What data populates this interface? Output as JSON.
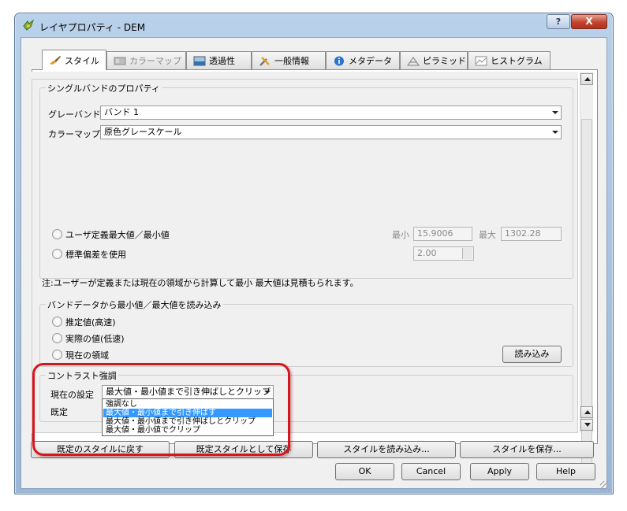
{
  "window": {
    "title": "レイヤプロパティ - DEM",
    "help_glyph": "?",
    "close_glyph": "X"
  },
  "tabs": [
    {
      "label": "スタイル",
      "icon": "brush-icon",
      "active": true
    },
    {
      "label": "カラーマップ",
      "icon": "colormap-icon",
      "disabled": true
    },
    {
      "label": "透過性",
      "icon": "transparency-icon"
    },
    {
      "label": "一般情報",
      "icon": "tools-icon"
    },
    {
      "label": "メタデータ",
      "icon": "info-icon"
    },
    {
      "label": "ピラミッド",
      "icon": "pyramid-icon"
    },
    {
      "label": "ヒストグラム",
      "icon": "histogram-icon"
    }
  ],
  "single_band": {
    "group_title": "シングルバンドのプロパティ",
    "gray_band_label": "グレーバンド",
    "gray_band_value": "バンド 1",
    "colormap_label": "カラーマップ",
    "colormap_value": "原色グレースケール",
    "user_minmax_label": "ユーザ定義最大値／最小値",
    "min_label": "最小",
    "min_value": "15.9006",
    "max_label": "最大",
    "max_value": "1302.28",
    "stddev_label": "標準偏差を使用",
    "stddev_value": "2.00"
  },
  "note": "注:ユーザーが定義または現在の領域から計算して最小 最大値は見積もられます。",
  "load_minmax": {
    "group_title": "バンドデータから最小値／最大値を読み込み",
    "options": [
      "推定値(高速)",
      "実際の値(低速)",
      "現在の領域"
    ],
    "load_button": "読み込み"
  },
  "contrast": {
    "group_title": "コントラスト強調",
    "current_label": "現在の設定",
    "current_value": "最大値・最小値まで引き伸ばしとクリップ",
    "default_label": "既定",
    "popup_items": [
      "強調なし",
      "最大値・最小値まで引き伸ばす",
      "最大値・最小値まで引き伸ばしとクリップ",
      "最大値・最小値でクリップ"
    ],
    "popup_selected_index": 1
  },
  "style_buttons": {
    "restore_default": "既定のスタイルに戻す",
    "save_as_default": "既定スタイルとして保存",
    "load_style": "スタイルを読み込み...",
    "save_style": "スタイルを保存..."
  },
  "dialog_buttons": {
    "ok": "OK",
    "cancel": "Cancel",
    "apply": "Apply",
    "help": "Help"
  },
  "colors": {
    "highlight": "#d8151b",
    "selection": "#3399ff"
  }
}
